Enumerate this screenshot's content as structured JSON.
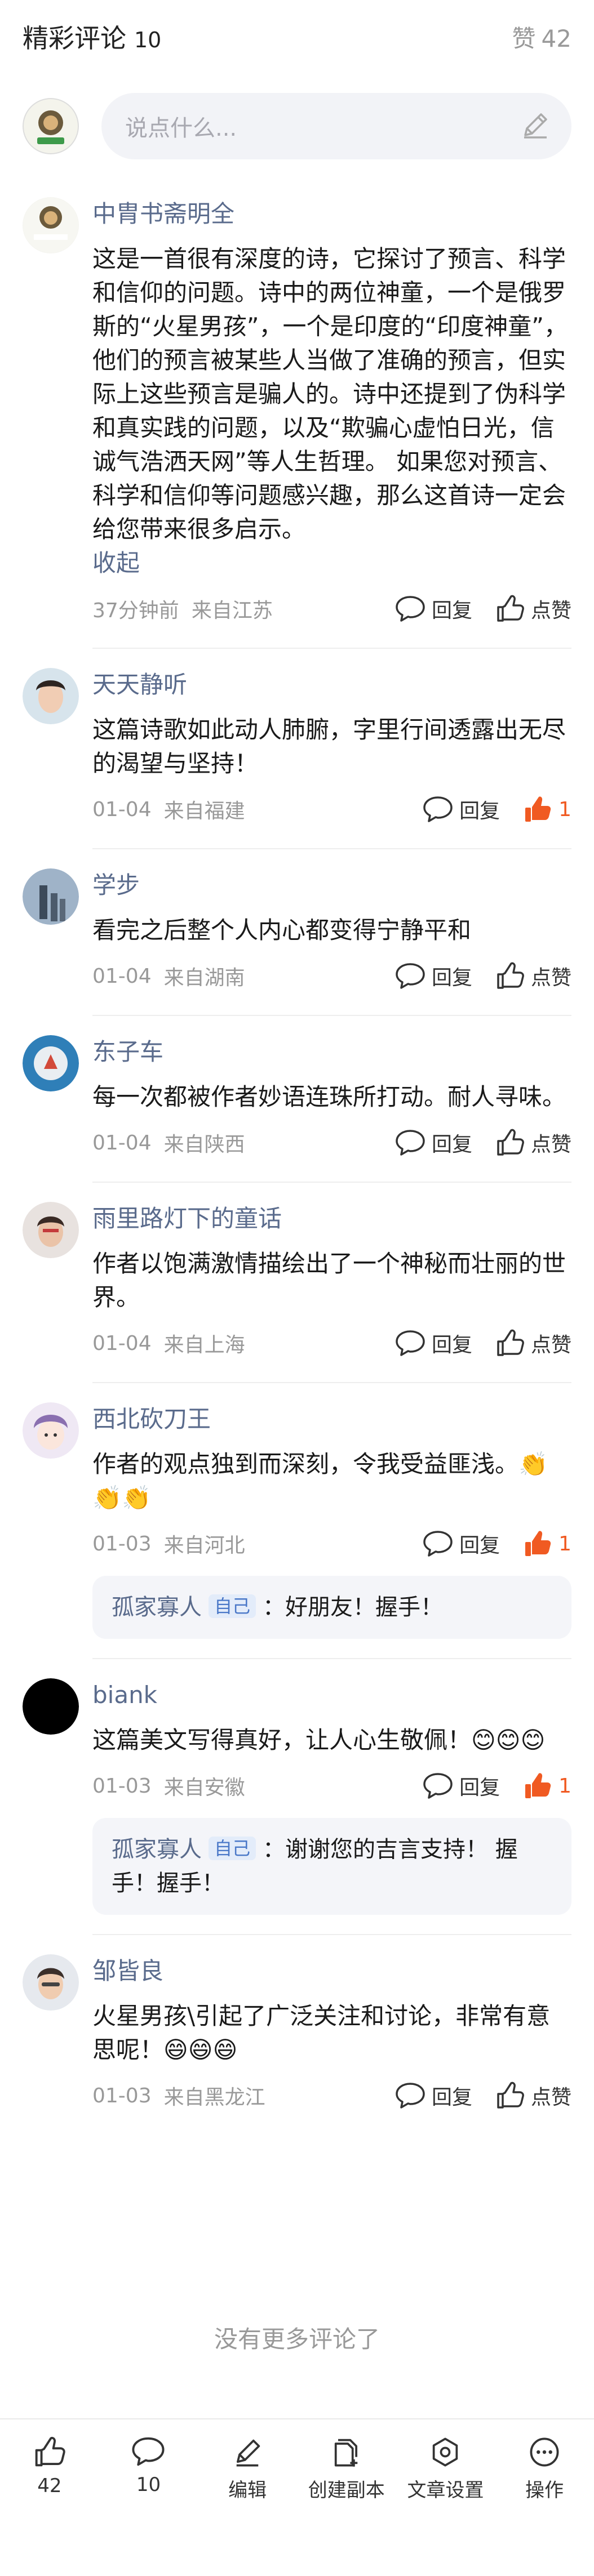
{
  "header": {
    "title": "精彩评论",
    "count": "10",
    "likes_label": "赞",
    "likes_count": "42"
  },
  "composer": {
    "placeholder": "说点什么..."
  },
  "comments": [
    {
      "name": "中胄书斋明全",
      "avatar_text": "中胄书斋明全",
      "body": "这是一首很有深度的诗，它探讨了预言、科学和信仰的问题。诗中的两位神童，一个是俄罗斯的“火星男孩”，一个是印度的“印度神童”，他们的预言被某些人当做了准确的预言，但实际上这些预言是骗人的。诗中还提到了伪科学和真实践的问题，以及“欺骗心虚怕日光，信诚气浩洒天网”等人生哲理。 如果您对预言、科学和信仰等问题感兴趣，那么这首诗一定会给您带来很多启示。",
      "fold": "收起",
      "time": "37分钟前",
      "location": "来自江苏",
      "reply_label": "回复",
      "like_label": "点赞"
    },
    {
      "name": "天天静听",
      "body": "这篇诗歌如此动人肺腑，字里行间透露出无尽的渴望与坚持！",
      "time": "01-04",
      "location": "来自福建",
      "reply_label": "回复",
      "like_label": "1"
    },
    {
      "name": "学步",
      "body": "看完之后整个人内心都变得宁静平和",
      "time": "01-04",
      "location": "来自湖南",
      "reply_label": "回复",
      "like_label": "点赞"
    },
    {
      "name": "东子车",
      "body": "每一次都被作者妙语连珠所打动。耐人寻味。",
      "time": "01-04",
      "location": "来自陕西",
      "reply_label": "回复",
      "like_label": "点赞"
    },
    {
      "name": "雨里路灯下的童话",
      "body": "作者以饱满激情描绘出了一个神秘而壮丽的世界。",
      "time": "01-04",
      "location": "来自上海",
      "reply_label": "回复",
      "like_label": "点赞"
    },
    {
      "name": "西北砍刀王",
      "body": "作者的观点独到而深刻，令我受益匪浅。👏👏👏",
      "time": "01-03",
      "location": "来自河北",
      "reply_label": "回复",
      "like_label": "1",
      "reply": {
        "name": "孤家寡人",
        "tag": "自己",
        "sep": "：",
        "text": "好朋友！握手！"
      }
    },
    {
      "name": "biank",
      "body": "这篇美文写得真好，让人心生敬佩！😊😊😊",
      "time": "01-03",
      "location": "来自安徽",
      "reply_label": "回复",
      "like_label": "1",
      "reply": {
        "name": "孤家寡人",
        "tag": "自己",
        "sep": "：",
        "text": "谢谢您的吉言支持！ 握手！握手！"
      }
    },
    {
      "name": "邹皆良",
      "body": "火星男孩\\引起了广泛关注和讨论，非常有意思呢！😄😄😄",
      "time": "01-03",
      "location": "来自黑龙江",
      "reply_label": "回复",
      "like_label": "点赞"
    }
  ],
  "no_more": "没有更多评论了",
  "toolbar": {
    "like_count": "42",
    "comment_count": "10",
    "edit": "编辑",
    "copy": "创建副本",
    "settings": "文章设置",
    "actions": "操作"
  },
  "colors": {
    "accent_name": "#5a6b8c",
    "liked": "#f05a22",
    "muted": "#999999"
  },
  "icons": [
    "pencil-icon",
    "reply-bubble-icon",
    "thumb-up-icon",
    "comment-icon",
    "edit-icon",
    "copy-icon",
    "settings-icon",
    "more-icon"
  ]
}
